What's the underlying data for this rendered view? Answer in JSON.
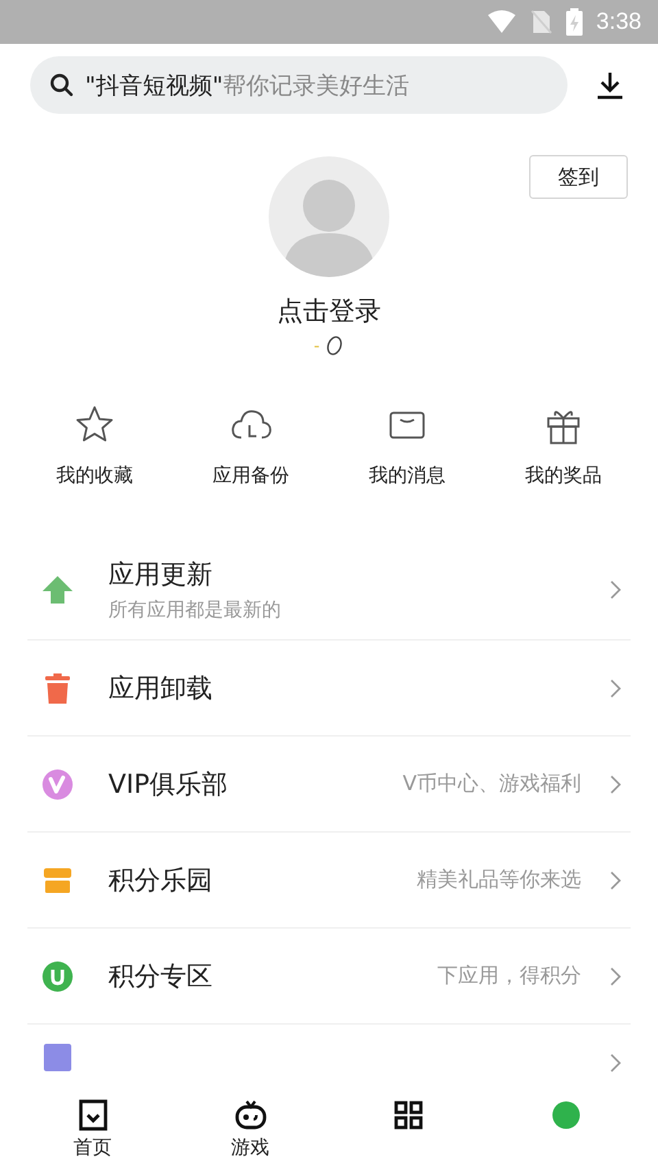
{
  "status_bar": {
    "time": "3:38"
  },
  "search": {
    "placeholder": "**\"抖音短视频\"**帮你记录美好生活"
  },
  "check_in": "签到",
  "profile": {
    "login": "点击登录",
    "points": "-"
  },
  "shortcuts": [
    {
      "label": "我的收藏"
    },
    {
      "label": "应用备份"
    },
    {
      "label": "我的消息"
    },
    {
      "label": "我的奖品"
    }
  ],
  "menu": [
    {
      "title": "应用更新",
      "subtitle": "所有应用都是最新的",
      "color": "#6cbd72"
    },
    {
      "title": "应用卸载",
      "color": "#f0694a"
    },
    {
      "title": "VIP俱乐部",
      "hint": "V币中心、游戏福利",
      "color": "#d98be0"
    },
    {
      "title": "积分乐园",
      "hint": "精美礼品等你来选",
      "color": "#f5a623"
    },
    {
      "title": "积分专区",
      "hint": "下应用，得积分",
      "color": "#3fb34f"
    },
    {
      "color": "#8c8ce6"
    }
  ],
  "bottom_nav": [
    {
      "label": "首页",
      "kind": "home"
    },
    {
      "label": "游戏",
      "kind": "game"
    },
    {
      "kind": "grid"
    },
    {
      "kind": "dot"
    }
  ]
}
